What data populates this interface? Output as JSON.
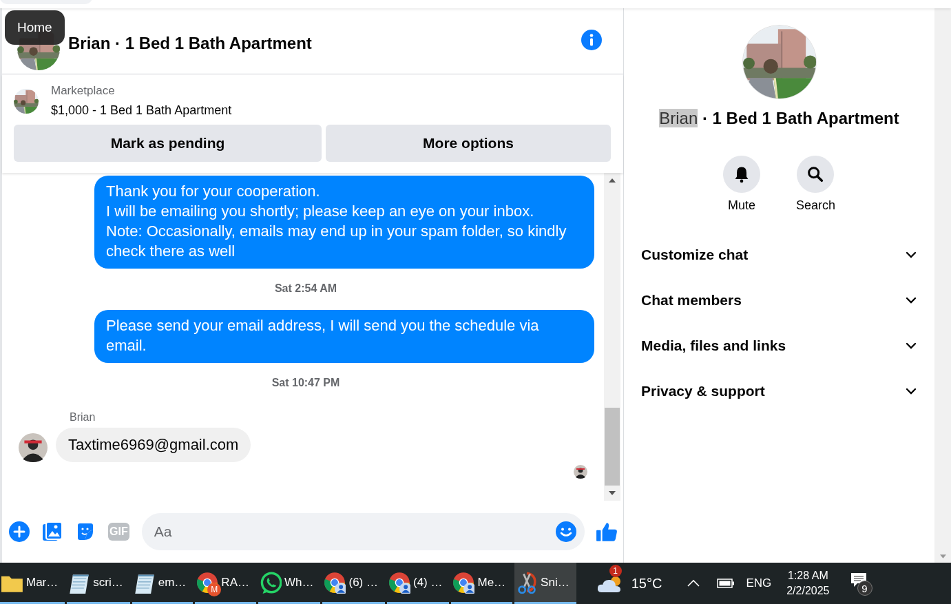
{
  "tooltip": {
    "label": "Home"
  },
  "chat_header": {
    "title": "Brian · 1 Bed 1 Bath Apartment"
  },
  "listing": {
    "source": "Marketplace",
    "title": "$1,000 - 1 Bed 1 Bath Apartment",
    "buttons": [
      "Mark as pending",
      "More options"
    ]
  },
  "messages": [
    {
      "kind": "outgoing",
      "text": "Thank you for your cooperation.\nI will be emailing you shortly; please keep an eye on your inbox.\nNote: Occasionally, emails may end up in your spam folder, so kindly check there as well"
    },
    {
      "kind": "timestamp",
      "text": "Sat 2:54 AM"
    },
    {
      "kind": "outgoing",
      "text": "Please send your email address, I will send you the schedule via email."
    },
    {
      "kind": "timestamp",
      "text": "Sat 10:47 PM"
    },
    {
      "kind": "incoming",
      "sender": "Brian",
      "text": "Taxtime6969@gmail.com"
    }
  ],
  "composer": {
    "placeholder": "Aa",
    "gif": "GIF"
  },
  "details": {
    "name": "Brian",
    "name_highlighted": true,
    "rest": "· 1 Bed 1 Bath Apartment"
  },
  "actions": [
    {
      "label": "Mute",
      "kind": "bell"
    },
    {
      "label": "Search",
      "kind": "search"
    }
  ],
  "sections": [
    {
      "label": "Customize chat",
      "expanded": false
    },
    {
      "label": "Chat members",
      "expanded": false
    },
    {
      "label": "Media, files and links",
      "expanded": false
    },
    {
      "label": "Privacy & support",
      "expanded": false
    }
  ],
  "taskbar": {
    "apps": [
      {
        "label": "Mar…",
        "kind": "folder",
        "active": false
      },
      {
        "label": "scri…",
        "kind": "notepad",
        "active": false
      },
      {
        "label": "em…",
        "kind": "notepad",
        "active": false
      },
      {
        "label": "RA…",
        "kind": "browser",
        "badge": "M",
        "active": false
      },
      {
        "label": "Wh…",
        "kind": "phone",
        "active": false
      },
      {
        "label": "(6) …",
        "kind": "browser-profile",
        "active": false
      },
      {
        "label": "(4) …",
        "kind": "browser-profile",
        "active": false
      },
      {
        "label": "Me…",
        "kind": "browser-profile",
        "active": false
      },
      {
        "label": "Sni…",
        "kind": "scissors",
        "active": true
      }
    ],
    "weather": {
      "badge": "1",
      "temperature": "15°C"
    },
    "language": "ENG",
    "time": "1:28 AM",
    "date": "2/2/2025",
    "notifications": "9"
  }
}
